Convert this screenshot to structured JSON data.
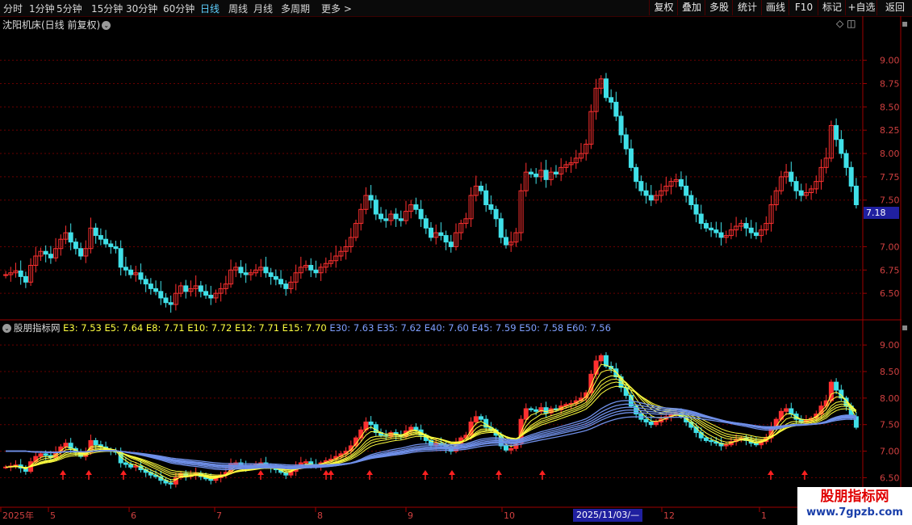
{
  "toolbar": {
    "periods": [
      "分时",
      "1分钟",
      "5分钟",
      "15分钟",
      "30分钟",
      "60分钟",
      "日线",
      "周线",
      "月线",
      "多周期",
      "更多 >"
    ],
    "active_period": "日线",
    "right_buttons": [
      "复权",
      "叠加",
      "多股",
      "统计",
      "画线",
      "F10",
      "标记",
      "+自选",
      "返回"
    ]
  },
  "main_title": "沈阳机床(日线 前复权)",
  "indicator": {
    "name": "股朋指标网",
    "values": [
      {
        "label": "E3: 7.53",
        "color": "#ffff40"
      },
      {
        "label": "E5: 7.64",
        "color": "#ffff40"
      },
      {
        "label": "E8: 7.71",
        "color": "#ffff40"
      },
      {
        "label": "E10: 7.72",
        "color": "#ffff40"
      },
      {
        "label": "E12: 7.71",
        "color": "#ffff40"
      },
      {
        "label": "E15: 7.70",
        "color": "#ffff40"
      },
      {
        "label": "E30: 7.63",
        "color": "#7f9fff"
      },
      {
        "label": "E35: 7.62",
        "color": "#7f9fff"
      },
      {
        "label": "E40: 7.60",
        "color": "#7f9fff"
      },
      {
        "label": "E45: 7.59",
        "color": "#7f9fff"
      },
      {
        "label": "E50: 7.58",
        "color": "#7f9fff"
      },
      {
        "label": "E60: 7.56",
        "color": "#7f9fff"
      }
    ]
  },
  "main_axis": {
    "labels": [
      "9.00",
      "8.75",
      "8.50",
      "8.25",
      "8.00",
      "7.75",
      "7.50",
      "7.00",
      "6.75",
      "6.50"
    ],
    "min": 6.25,
    "max": 9.3
  },
  "ind_axis": {
    "labels": [
      "9.00",
      "8.50",
      "8.00",
      "7.50",
      "7.00",
      "6.50"
    ],
    "min": 6.4,
    "max": 9.2
  },
  "current_price": "7.18",
  "x_axis": {
    "labels": [
      "2025年",
      "5",
      "6",
      "7",
      "8",
      "9",
      "10",
      "12",
      "1"
    ],
    "cursor_date": "2025/11/03/—"
  },
  "watermark": {
    "cn": "股朋指标网",
    "url": "www.7gpzb.com"
  },
  "colors": {
    "up": "#ff3030",
    "down": "#40e0e8",
    "grid": "#6a0000",
    "axis": "#a00000",
    "yellow": "#ffff40",
    "blue": "#6f8fe8"
  },
  "chart_data": {
    "type": "candlestick",
    "title": "沈阳机床(日线 前复权)",
    "close_series": [
      6.7,
      6.72,
      6.74,
      6.68,
      6.62,
      6.8,
      6.9,
      6.95,
      6.92,
      6.88,
      6.98,
      7.08,
      7.15,
      7.05,
      6.98,
      6.9,
      6.98,
      7.2,
      7.12,
      7.08,
      7.03,
      7.0,
      6.98,
      6.78,
      6.75,
      6.7,
      6.72,
      6.65,
      6.6,
      6.55,
      6.52,
      6.45,
      6.4,
      6.38,
      6.5,
      6.58,
      6.52,
      6.55,
      6.58,
      6.52,
      6.48,
      6.45,
      6.5,
      6.55,
      6.6,
      6.75,
      6.78,
      6.72,
      6.7,
      6.72,
      6.75,
      6.78,
      6.72,
      6.68,
      6.65,
      6.6,
      6.55,
      6.62,
      6.72,
      6.78,
      6.8,
      6.75,
      6.72,
      6.78,
      6.82,
      6.85,
      6.9,
      6.95,
      7.0,
      7.1,
      7.25,
      7.4,
      7.55,
      7.5,
      7.35,
      7.3,
      7.28,
      7.35,
      7.3,
      7.28,
      7.38,
      7.45,
      7.4,
      7.3,
      7.2,
      7.1,
      7.15,
      7.12,
      7.05,
      7.0,
      7.15,
      7.25,
      7.3,
      7.55,
      7.65,
      7.6,
      7.45,
      7.4,
      7.3,
      7.1,
      7.02,
      7.05,
      7.15,
      7.6,
      7.8,
      7.78,
      7.75,
      7.82,
      7.72,
      7.8,
      7.78,
      7.85,
      7.88,
      7.9,
      7.95,
      8.0,
      8.1,
      8.45,
      8.7,
      8.8,
      8.6,
      8.55,
      8.4,
      8.2,
      8.05,
      7.85,
      7.7,
      7.6,
      7.55,
      7.5,
      7.55,
      7.6,
      7.65,
      7.7,
      7.72,
      7.65,
      7.55,
      7.45,
      7.35,
      7.25,
      7.2,
      7.18,
      7.15,
      7.1,
      7.12,
      7.18,
      7.22,
      7.25,
      7.2,
      7.15,
      7.12,
      7.18,
      7.25,
      7.45,
      7.6,
      7.75,
      7.8,
      7.7,
      7.6,
      7.55,
      7.58,
      7.62,
      7.7,
      7.85,
      7.95,
      8.3,
      8.15,
      8.0,
      7.85,
      7.65,
      7.45
    ]
  }
}
